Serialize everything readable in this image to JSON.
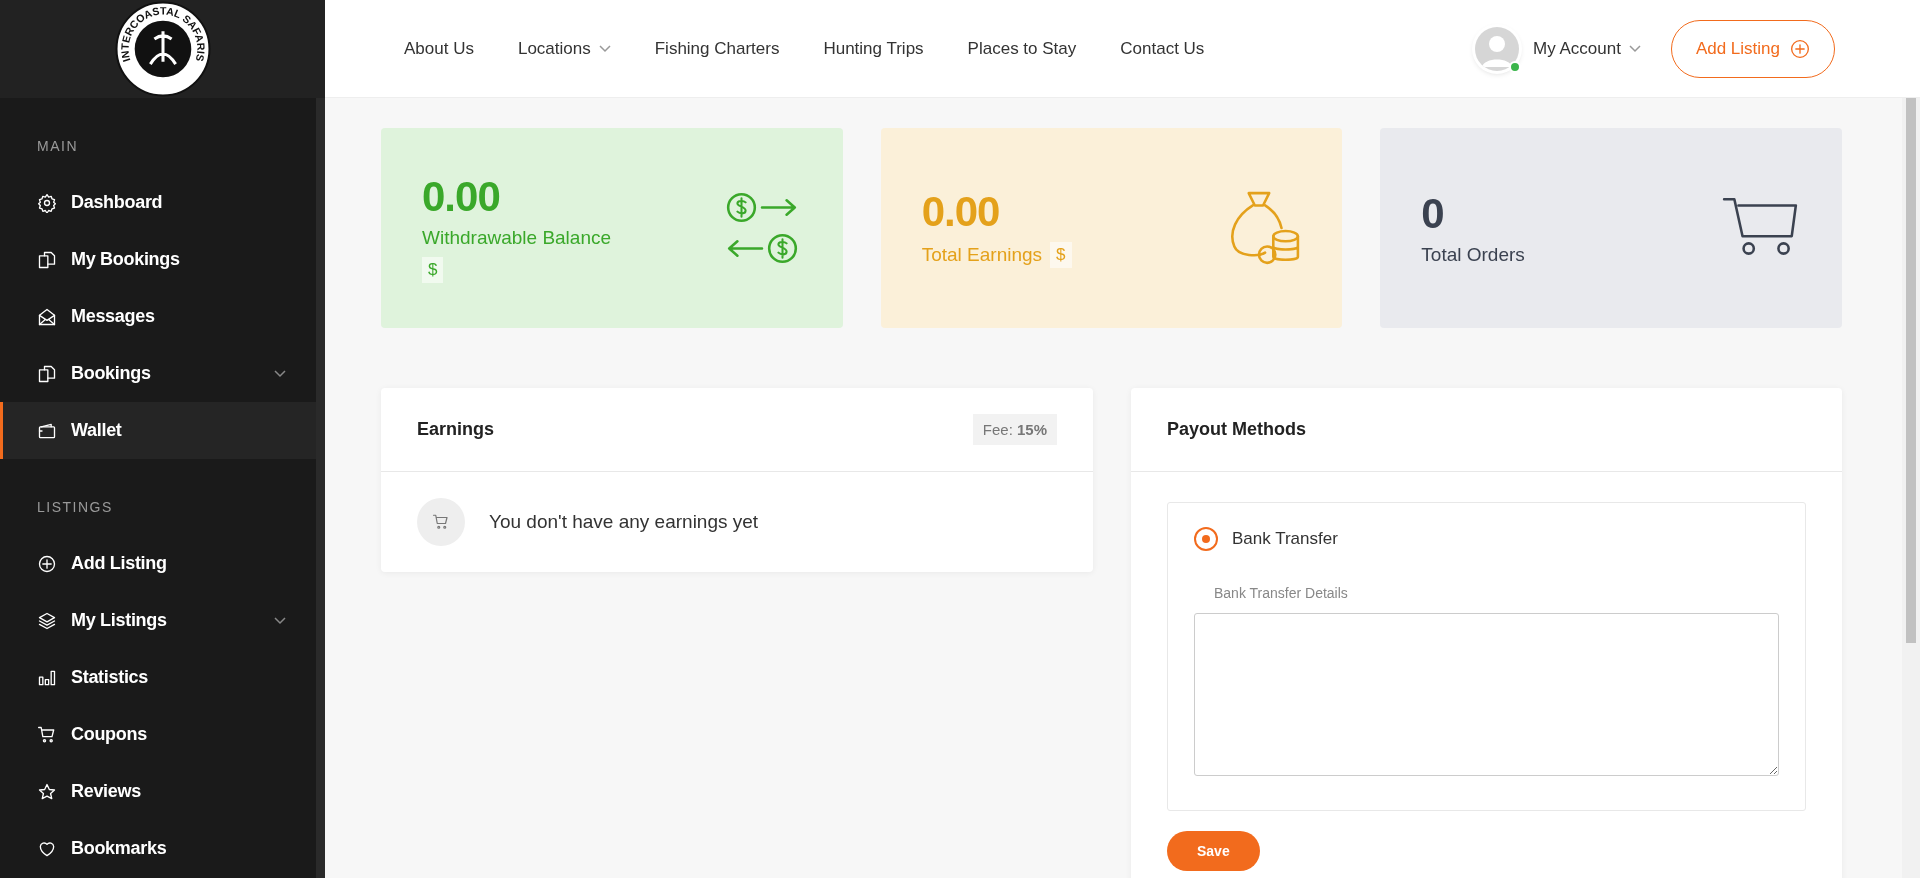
{
  "logo": {
    "text": "INTERCOASTAL SAFARIS"
  },
  "sidebar": {
    "sections": [
      {
        "title": "MAIN",
        "items": [
          {
            "label": "Dashboard",
            "selected": false,
            "has_submenu": false
          },
          {
            "label": "My Bookings",
            "selected": false,
            "has_submenu": false
          },
          {
            "label": "Messages",
            "selected": false,
            "has_submenu": false
          },
          {
            "label": "Bookings",
            "selected": false,
            "has_submenu": true
          },
          {
            "label": "Wallet",
            "selected": true,
            "has_submenu": false
          }
        ]
      },
      {
        "title": "LISTINGS",
        "items": [
          {
            "label": "Add Listing",
            "selected": false,
            "has_submenu": false
          },
          {
            "label": "My Listings",
            "selected": false,
            "has_submenu": true
          },
          {
            "label": "Statistics",
            "selected": false,
            "has_submenu": false
          },
          {
            "label": "Coupons",
            "selected": false,
            "has_submenu": false
          },
          {
            "label": "Reviews",
            "selected": false,
            "has_submenu": false
          },
          {
            "label": "Bookmarks",
            "selected": false,
            "has_submenu": false
          }
        ]
      }
    ]
  },
  "nav": [
    {
      "label": "About Us",
      "has_dropdown": false
    },
    {
      "label": "Locations",
      "has_dropdown": true
    },
    {
      "label": "Fishing Charters",
      "has_dropdown": false
    },
    {
      "label": "Hunting Trips",
      "has_dropdown": false
    },
    {
      "label": "Places to Stay",
      "has_dropdown": false
    },
    {
      "label": "Contact Us",
      "has_dropdown": false
    }
  ],
  "account": {
    "label": "My Account",
    "online": true
  },
  "add_listing_button": "Add Listing",
  "stats": [
    {
      "kind": "balance",
      "value": "0.00",
      "label": "Withdrawable Balance",
      "currency": "$"
    },
    {
      "kind": "earnings",
      "value": "0.00",
      "label": "Total Earnings",
      "currency": "$"
    },
    {
      "kind": "orders",
      "value": "0",
      "label": "Total Orders"
    }
  ],
  "earnings": {
    "title": "Earnings",
    "fee": "Fee: **15%**",
    "empty_message": "You don't have any earnings yet"
  },
  "payout": {
    "title": "Payout Methods",
    "methods": [
      {
        "label": "Bank Transfer",
        "selected": true
      }
    ],
    "details_label": "Bank Transfer Details",
    "save_button": "Save"
  }
}
